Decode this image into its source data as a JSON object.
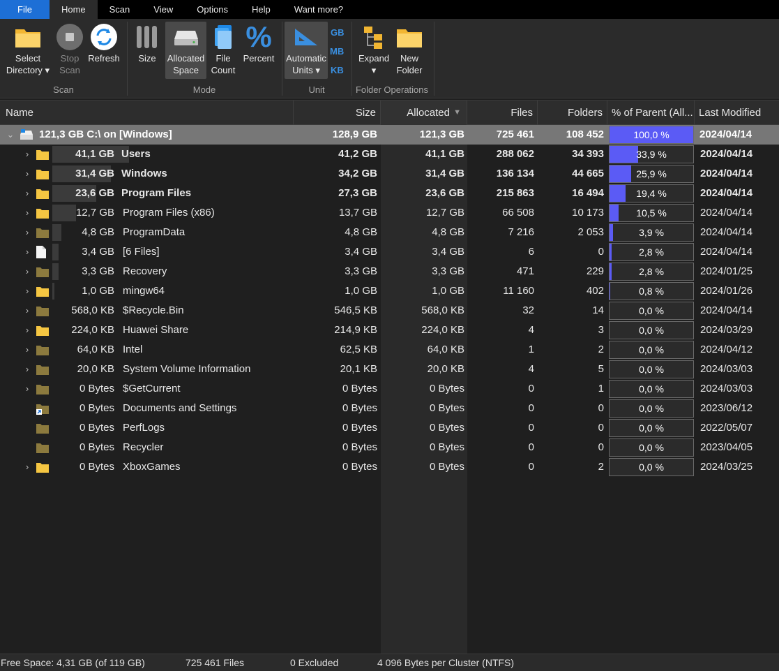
{
  "menu": [
    "File",
    "Home",
    "Scan",
    "View",
    "Options",
    "Help",
    "Want more?"
  ],
  "ribbon": {
    "scan_group": "Scan",
    "select_directory": [
      "Select",
      "Directory ▾"
    ],
    "stop_scan": [
      "Stop",
      "Scan"
    ],
    "refresh": "Refresh",
    "mode_group": "Mode",
    "size": "Size",
    "allocated_space": [
      "Allocated",
      "Space"
    ],
    "file_count": [
      "File",
      "Count"
    ],
    "percent": "Percent",
    "unit_group": "Unit",
    "automatic_units": [
      "Automatic",
      "Units ▾"
    ],
    "units": [
      "GB",
      "MB",
      "KB"
    ],
    "folder_ops_group": "Folder Operations",
    "expand": [
      "Expand",
      "▾"
    ],
    "new_folder": [
      "New",
      "Folder"
    ]
  },
  "columns": {
    "name": "Name",
    "size": "Size",
    "allocated": "Allocated",
    "files": "Files",
    "folders": "Folders",
    "percent": "% of Parent (All...",
    "modified": "Last Modified"
  },
  "root": {
    "label": "121,3 GB   C:\\  on  [Windows]",
    "size": "128,9 GB",
    "allocated": "121,3 GB",
    "files": "725 461",
    "folders": "108 452",
    "percent": "100,0 %",
    "fill": 1.0,
    "modified": "2024/04/14"
  },
  "rows": [
    {
      "alloc_label": "41,1 GB",
      "name": "Users",
      "size": "41,2 GB",
      "allocated": "41,1 GB",
      "files": "288 062",
      "folders": "34 393",
      "percent": "33,9 %",
      "fill": 0.339,
      "modified": "2024/04/14",
      "bold": true,
      "icon": "folder-icon",
      "expandable": true
    },
    {
      "alloc_label": "31,4 GB",
      "name": "Windows",
      "size": "34,2 GB",
      "allocated": "31,4 GB",
      "files": "136 134",
      "folders": "44 665",
      "percent": "25,9 %",
      "fill": 0.259,
      "modified": "2024/04/14",
      "bold": true,
      "icon": "folder-icon",
      "expandable": true
    },
    {
      "alloc_label": "23,6 GB",
      "name": "Program Files",
      "size": "27,3 GB",
      "allocated": "23,6 GB",
      "files": "215 863",
      "folders": "16 494",
      "percent": "19,4 %",
      "fill": 0.194,
      "modified": "2024/04/14",
      "bold": true,
      "icon": "folder-icon",
      "expandable": true
    },
    {
      "alloc_label": "12,7 GB",
      "name": "Program Files (x86)",
      "size": "13,7 GB",
      "allocated": "12,7 GB",
      "files": "66 508",
      "folders": "10 173",
      "percent": "10,5 %",
      "fill": 0.105,
      "modified": "2024/04/14",
      "bold": false,
      "icon": "folder-icon",
      "expandable": true
    },
    {
      "alloc_label": "4,8 GB",
      "name": "ProgramData",
      "size": "4,8 GB",
      "allocated": "4,8 GB",
      "files": "7 216",
      "folders": "2 053",
      "percent": "3,9 %",
      "fill": 0.039,
      "modified": "2024/04/14",
      "bold": false,
      "icon": "hidden-folder-icon",
      "expandable": true
    },
    {
      "alloc_label": "3,4 GB",
      "name": "[6 Files]",
      "size": "3,4 GB",
      "allocated": "3,4 GB",
      "files": "6",
      "folders": "0",
      "percent": "2,8 %",
      "fill": 0.028,
      "modified": "2024/04/14",
      "bold": false,
      "icon": "file-icon",
      "expandable": true
    },
    {
      "alloc_label": "3,3 GB",
      "name": "Recovery",
      "size": "3,3 GB",
      "allocated": "3,3 GB",
      "files": "471",
      "folders": "229",
      "percent": "2,8 %",
      "fill": 0.028,
      "modified": "2024/01/25",
      "bold": false,
      "icon": "hidden-folder-icon",
      "expandable": true
    },
    {
      "alloc_label": "1,0 GB",
      "name": "mingw64",
      "size": "1,0 GB",
      "allocated": "1,0 GB",
      "files": "11 160",
      "folders": "402",
      "percent": "0,8 %",
      "fill": 0.008,
      "modified": "2024/01/26",
      "bold": false,
      "icon": "folder-icon",
      "expandable": true
    },
    {
      "alloc_label": "568,0 KB",
      "name": "$Recycle.Bin",
      "size": "546,5 KB",
      "allocated": "568,0 KB",
      "files": "32",
      "folders": "14",
      "percent": "0,0 %",
      "fill": 0,
      "modified": "2024/04/14",
      "bold": false,
      "icon": "hidden-folder-icon",
      "expandable": true
    },
    {
      "alloc_label": "224,0 KB",
      "name": "Huawei Share",
      "size": "214,9 KB",
      "allocated": "224,0 KB",
      "files": "4",
      "folders": "3",
      "percent": "0,0 %",
      "fill": 0,
      "modified": "2024/03/29",
      "bold": false,
      "icon": "folder-icon",
      "expandable": true
    },
    {
      "alloc_label": "64,0 KB",
      "name": "Intel",
      "size": "62,5 KB",
      "allocated": "64,0 KB",
      "files": "1",
      "folders": "2",
      "percent": "0,0 %",
      "fill": 0,
      "modified": "2024/04/12",
      "bold": false,
      "icon": "hidden-folder-icon",
      "expandable": true
    },
    {
      "alloc_label": "20,0 KB",
      "name": "System Volume Information",
      "size": "20,1 KB",
      "allocated": "20,0 KB",
      "files": "4",
      "folders": "5",
      "percent": "0,0 %",
      "fill": 0,
      "modified": "2024/03/03",
      "bold": false,
      "icon": "hidden-folder-icon",
      "expandable": true
    },
    {
      "alloc_label": "0 Bytes",
      "name": "$GetCurrent",
      "size": "0 Bytes",
      "allocated": "0 Bytes",
      "files": "0",
      "folders": "1",
      "percent": "0,0 %",
      "fill": 0,
      "modified": "2024/03/03",
      "bold": false,
      "icon": "hidden-folder-icon",
      "expandable": true
    },
    {
      "alloc_label": "0 Bytes",
      "name": "Documents and Settings",
      "size": "0 Bytes",
      "allocated": "0 Bytes",
      "files": "0",
      "folders": "0",
      "percent": "0,0 %",
      "fill": 0,
      "modified": "2023/06/12",
      "bold": false,
      "icon": "shortcut-folder-icon",
      "expandable": false
    },
    {
      "alloc_label": "0 Bytes",
      "name": "PerfLogs",
      "size": "0 Bytes",
      "allocated": "0 Bytes",
      "files": "0",
      "folders": "0",
      "percent": "0,0 %",
      "fill": 0,
      "modified": "2022/05/07",
      "bold": false,
      "icon": "hidden-folder-icon",
      "expandable": false
    },
    {
      "alloc_label": "0 Bytes",
      "name": "Recycler",
      "size": "0 Bytes",
      "allocated": "0 Bytes",
      "files": "0",
      "folders": "0",
      "percent": "0,0 %",
      "fill": 0,
      "modified": "2023/04/05",
      "bold": false,
      "icon": "hidden-folder-icon",
      "expandable": false
    },
    {
      "alloc_label": "0 Bytes",
      "name": "XboxGames",
      "size": "0 Bytes",
      "allocated": "0 Bytes",
      "files": "0",
      "folders": "2",
      "percent": "0,0 %",
      "fill": 0,
      "modified": "2024/03/25",
      "bold": false,
      "icon": "folder-icon",
      "expandable": true
    }
  ],
  "status": {
    "free_space": "Free Space: 4,31 GB  (of 119 GB)",
    "files": "725 461 Files",
    "excluded": "0 Excluded",
    "cluster": "4 096 Bytes per Cluster (NTFS)"
  },
  "colors": {
    "percent_bar": "#5b5bf5",
    "accent_blue": "#1d6fd6",
    "folder_yellow": "#f5c542",
    "hidden_folder": "#8c7a3e"
  }
}
